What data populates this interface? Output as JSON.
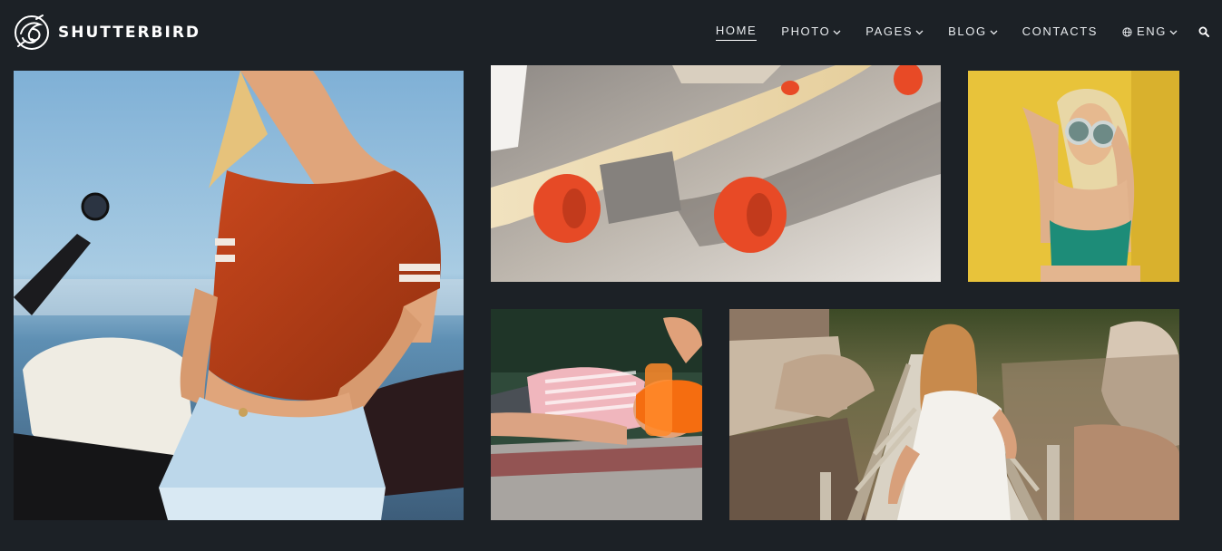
{
  "brand": {
    "name": "SHUTTERBIRD",
    "logo_icon": "bird-camera-logo"
  },
  "nav": {
    "items": [
      {
        "label": "HOME",
        "active": true,
        "dropdown": false
      },
      {
        "label": "PHOTO",
        "active": false,
        "dropdown": true
      },
      {
        "label": "PAGES",
        "active": false,
        "dropdown": true
      },
      {
        "label": "BLOG",
        "active": false,
        "dropdown": true
      },
      {
        "label": "CONTACTS",
        "active": false,
        "dropdown": false
      },
      {
        "label": "ENG",
        "active": false,
        "dropdown": true,
        "icon": "globe-icon"
      }
    ],
    "search_icon": "search-icon"
  },
  "gallery": {
    "photos": [
      {
        "subject": "woman-in-orange-top-by-motorcycle"
      },
      {
        "subject": "longboard-orange-wheels"
      },
      {
        "subject": "woman-sunglasses-yellow-wall"
      },
      {
        "subject": "woman-lying-orange-visor"
      },
      {
        "subject": "woman-white-dress-wooden-bridge"
      }
    ]
  },
  "colors": {
    "background": "#1c2126",
    "nav_text": "#e8ebee",
    "accent_orange": "#c2451c"
  }
}
